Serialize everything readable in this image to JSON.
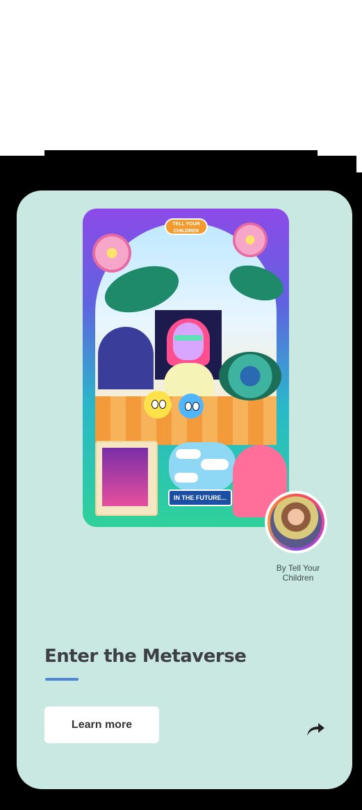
{
  "artwork": {
    "logo_text": "TELL YOUR CHILDREN",
    "caption": "IN THE FUTURE..."
  },
  "creator": {
    "label": "By Tell Your Children"
  },
  "section": {
    "title": "Enter the Metaverse"
  },
  "actions": {
    "learn_more_label": "Learn more",
    "share_icon": "share-arrow-icon"
  },
  "colors": {
    "card_background": "#c9e8e2",
    "accent_underline": "#4b86d1",
    "button_background": "#ffffff",
    "page_frame": "#000000"
  }
}
